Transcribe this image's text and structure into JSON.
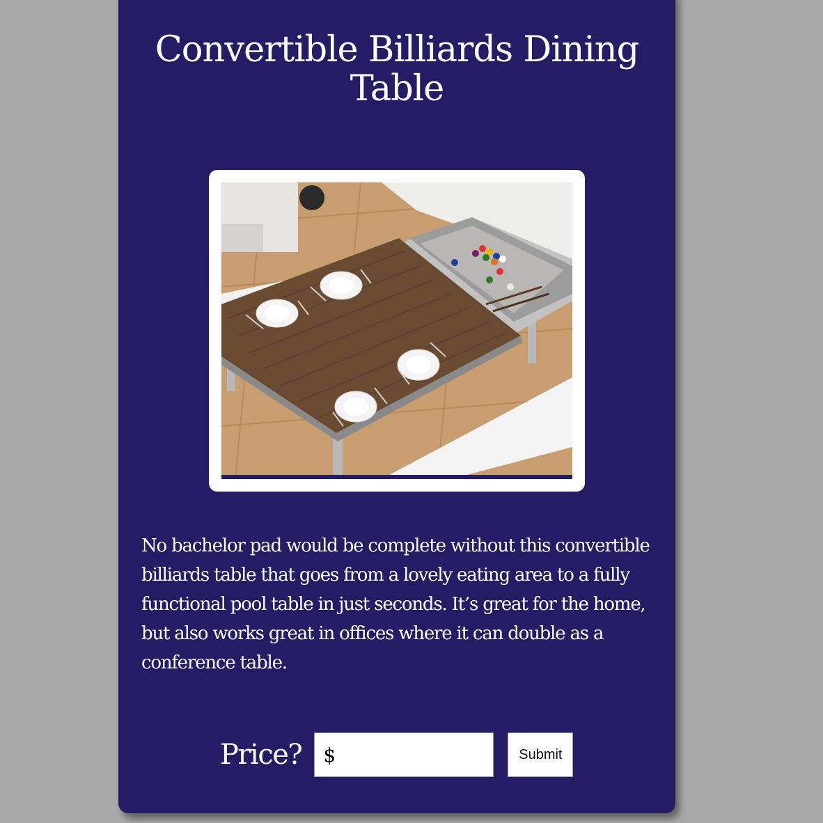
{
  "card": {
    "title": "Convertible Billiards Dining Table",
    "description": "No bachelor pad would be complete without this convertible billiards table that goes from a lovely eating area to a fully functional pool table in just seconds. It’s great for the home, but also works great in offices where it can double as a conference table."
  },
  "form": {
    "price_label": "Price?",
    "price_value": "$",
    "submit_label": "Submit"
  },
  "colors": {
    "page_background": "#a9a9a9",
    "card_background": "#241d66",
    "text": "#ffffff"
  }
}
